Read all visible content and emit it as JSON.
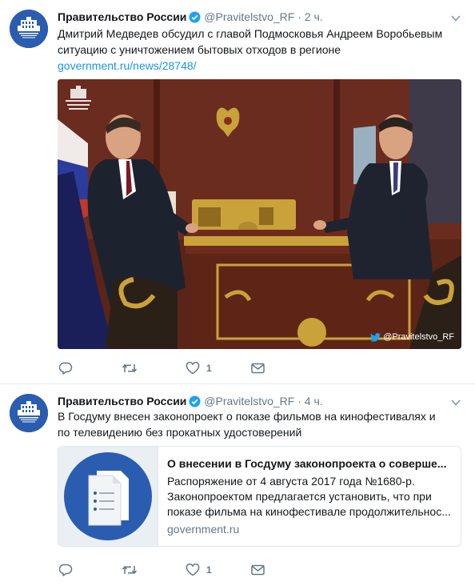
{
  "tweets": [
    {
      "author_name": "Правительство России",
      "handle": "@Pravitelstvo_RF",
      "separator": "·",
      "time": "2 ч.",
      "text_line1": "Дмитрий Медведев обсудил с главой Подмосковья Андреем Воробьевым",
      "text_line2": "ситуацию с уничтожением бытовых отходов в регионе",
      "link": "government.ru/news/28748/",
      "photo_watermark": "@Pravitelstvo_RF",
      "likes": "1"
    },
    {
      "author_name": "Правительство России",
      "handle": "@Pravitelstvo_RF",
      "separator": "·",
      "time": "4 ч.",
      "text_line1": "В Госдуму внесен законопроект о показе фильмов на кинофестивалях и",
      "text_line2": "по телевидению без прокатных удостоверений",
      "card": {
        "title": "О внесении в Госдуму законопроекта о соверше...",
        "desc_line1": "Распоряжение от 4 августа 2017 года №1680-р.",
        "desc_line2": "Законопроектом предлагается установить, что при",
        "desc_line3": "показе фильма на кинофестивале продолжительнос...",
        "domain": "government.ru"
      },
      "likes": "1"
    }
  ],
  "colors": {
    "link": "#1b95e0",
    "secondary_text": "#657786",
    "avatar_bg": "#2a5db0",
    "card_icon_bg": "#2a5db0"
  },
  "icons": [
    "verified-badge-icon",
    "chevron-down-icon",
    "reply-icon",
    "retweet-icon",
    "like-icon",
    "direct-message-icon",
    "twitter-bird-icon",
    "document-icon"
  ]
}
